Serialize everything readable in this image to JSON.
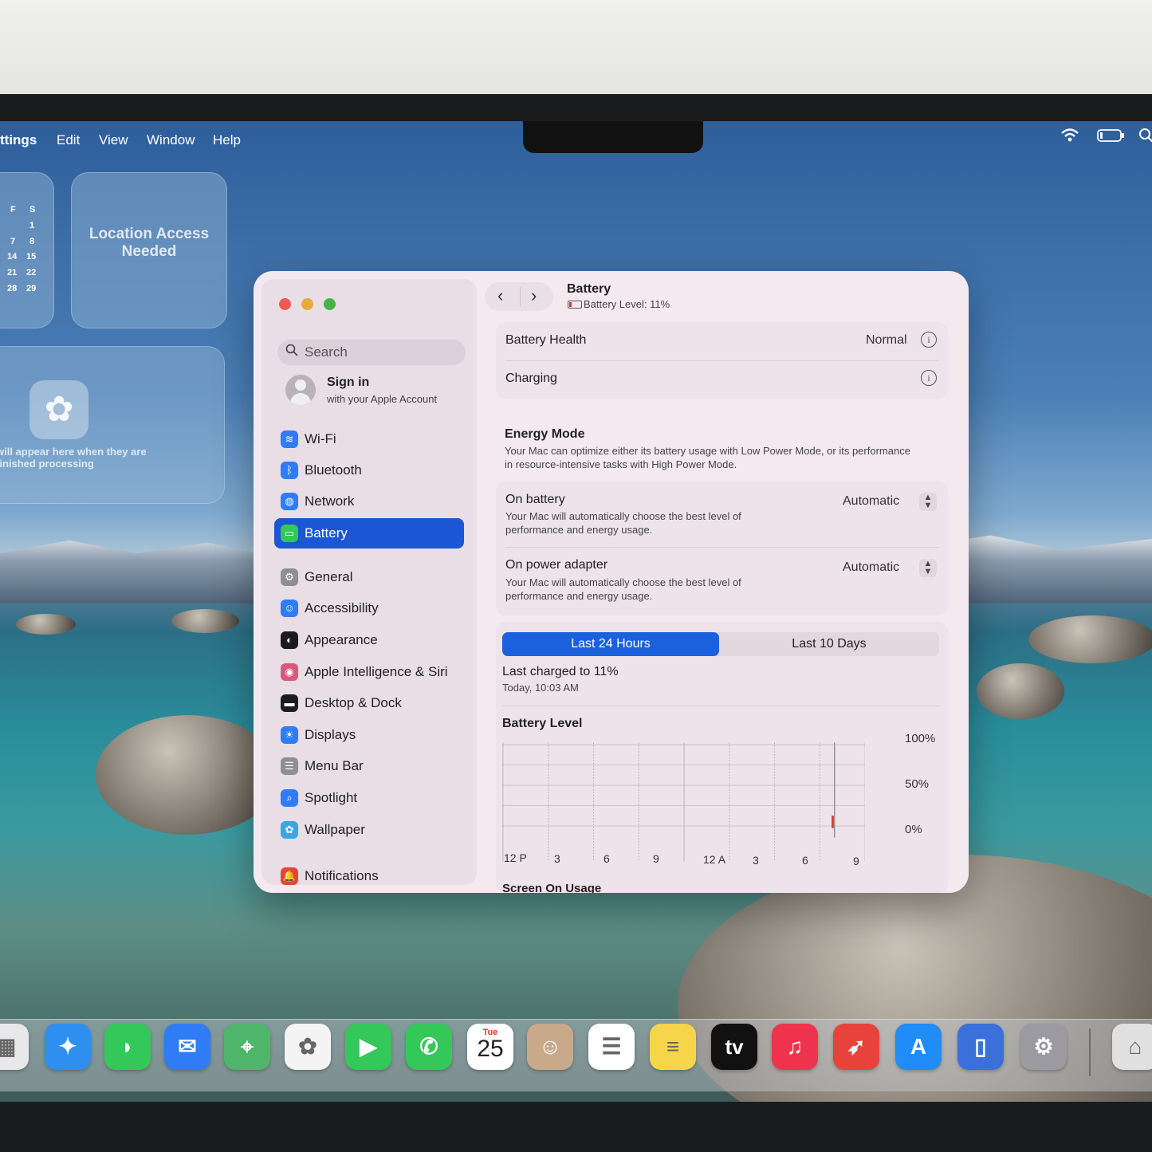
{
  "menubar": {
    "app_menu": "ttings",
    "items": [
      "Edit",
      "View",
      "Window",
      "Help"
    ],
    "wifi_icon": "wifi-icon",
    "battery_icon": "battery-icon",
    "search_icon": "search-icon"
  },
  "widgets": {
    "calendar": {
      "headers": [
        "F",
        "S"
      ],
      "rows": [
        [
          "",
          "1"
        ],
        [
          "7",
          "8"
        ],
        [
          "14",
          "15"
        ],
        [
          "21",
          "22"
        ],
        [
          "28",
          "29"
        ]
      ]
    },
    "location": {
      "text": "Location Access Needed"
    },
    "photos": {
      "text": "will appear here when they are finished processing"
    }
  },
  "window": {
    "sidebar": {
      "search_placeholder": "Search",
      "account": {
        "title": "Sign in",
        "subtitle": "with your Apple Account"
      },
      "items": [
        {
          "label": "Wi-Fi",
          "icon": "wifi-icon",
          "color": "#2f7cf6"
        },
        {
          "label": "Bluetooth",
          "icon": "bluetooth-icon",
          "color": "#2f7cf6"
        },
        {
          "label": "Network",
          "icon": "globe-icon",
          "color": "#2f7cf6"
        },
        {
          "label": "Battery",
          "icon": "battery-icon",
          "color": "#35c759",
          "selected": true
        },
        {
          "label": "General",
          "icon": "gear-icon",
          "color": "#8e8e93"
        },
        {
          "label": "Accessibility",
          "icon": "accessibility-icon",
          "color": "#2f7cf6"
        },
        {
          "label": "Appearance",
          "icon": "appearance-icon",
          "color": "#1c1c1e"
        },
        {
          "label": "Apple Intelligence & Siri",
          "icon": "siri-icon",
          "color": "#d9587e"
        },
        {
          "label": "Desktop & Dock",
          "icon": "dock-icon",
          "color": "#1c1c1e"
        },
        {
          "label": "Displays",
          "icon": "sun-icon",
          "color": "#2f7cf6"
        },
        {
          "label": "Menu Bar",
          "icon": "menubar-icon",
          "color": "#8e8e93"
        },
        {
          "label": "Spotlight",
          "icon": "spotlight-icon",
          "color": "#2f7cf6"
        },
        {
          "label": "Wallpaper",
          "icon": "flower-icon",
          "color": "#3aa7e0"
        },
        {
          "label": "Notifications",
          "icon": "bell-icon",
          "color": "#e8433a"
        }
      ]
    },
    "header": {
      "back_icon": "chevron-left-icon",
      "forward_icon": "chevron-right-icon",
      "title": "Battery",
      "subtitle": "Battery Level: 11%"
    },
    "health": {
      "battery_health_label": "Battery Health",
      "battery_health_value": "Normal",
      "charging_label": "Charging"
    },
    "energy": {
      "title": "Energy Mode",
      "description": "Your Mac can optimize either its battery usage with Low Power Mode, or its performance in resource-intensive tasks with High Power Mode.",
      "on_battery": {
        "label": "On battery",
        "description": "Your Mac will automatically choose the best level of performance and energy usage.",
        "value": "Automatic"
      },
      "on_power_adapter": {
        "label": "On power adapter",
        "description": "Your Mac will automatically choose the best level of performance and energy usage.",
        "value": "Automatic"
      }
    },
    "usage": {
      "tabs": [
        "Last 24 Hours",
        "Last 10 Days"
      ],
      "selected_tab": "Last 24 Hours",
      "last_charged": "Last charged to 11%",
      "last_charged_time": "Today, 10:03 AM",
      "chart_title": "Battery Level",
      "next_section": "Screen On Usage"
    }
  },
  "chart_data": {
    "type": "bar",
    "title": "Battery Level",
    "x_ticks": [
      "12 P",
      "3",
      "6",
      "9",
      "12 A",
      "3",
      "6",
      "9"
    ],
    "y_ticks": [
      "100%",
      "50%",
      "0%"
    ],
    "ylim": [
      0,
      100
    ],
    "values": [
      15
    ],
    "bar_color": "#e0332d"
  },
  "dock": {
    "apps": [
      {
        "name": "launchpad",
        "icon": "launchpad-icon",
        "color": "#e8e8ea"
      },
      {
        "name": "safari",
        "icon": "compass-icon",
        "color": "#2f8ff0"
      },
      {
        "name": "messages",
        "icon": "message-bubble-icon",
        "color": "#34c759"
      },
      {
        "name": "mail",
        "icon": "envelope-icon",
        "color": "#2f7cf6"
      },
      {
        "name": "maps",
        "icon": "map-icon",
        "color": "#4fb56a"
      },
      {
        "name": "photos",
        "icon": "flower-icon",
        "color": "#f4f4f4"
      },
      {
        "name": "facetime",
        "icon": "video-camera-icon",
        "color": "#34c759"
      },
      {
        "name": "phone",
        "icon": "phone-icon",
        "color": "#34c759"
      },
      {
        "name": "calendar",
        "icon": "calendar-icon",
        "color": "#ffffff",
        "day_label": "Tue",
        "date": "25"
      },
      {
        "name": "contacts",
        "icon": "contacts-icon",
        "color": "#c8a98a"
      },
      {
        "name": "reminders",
        "icon": "list-icon",
        "color": "#ffffff"
      },
      {
        "name": "notes",
        "icon": "notes-icon",
        "color": "#f7d54a"
      },
      {
        "name": "apple-tv",
        "icon": "tv-icon",
        "color": "#111111",
        "text": "tv"
      },
      {
        "name": "music",
        "icon": "music-note-icon",
        "color": "#f0334c"
      },
      {
        "name": "rocket",
        "icon": "rocket-icon",
        "color": "#e8433a"
      },
      {
        "name": "app-store",
        "icon": "app-store-icon",
        "color": "#1f8cf7"
      },
      {
        "name": "iphone-mirroring",
        "icon": "iphone-icon",
        "color": "#3b6fd9"
      },
      {
        "name": "system-settings",
        "icon": "gear-icon",
        "color": "#9a9aa0"
      },
      {
        "name": "preview",
        "icon": "preview-icon",
        "color": "#e0e0e0"
      }
    ]
  }
}
